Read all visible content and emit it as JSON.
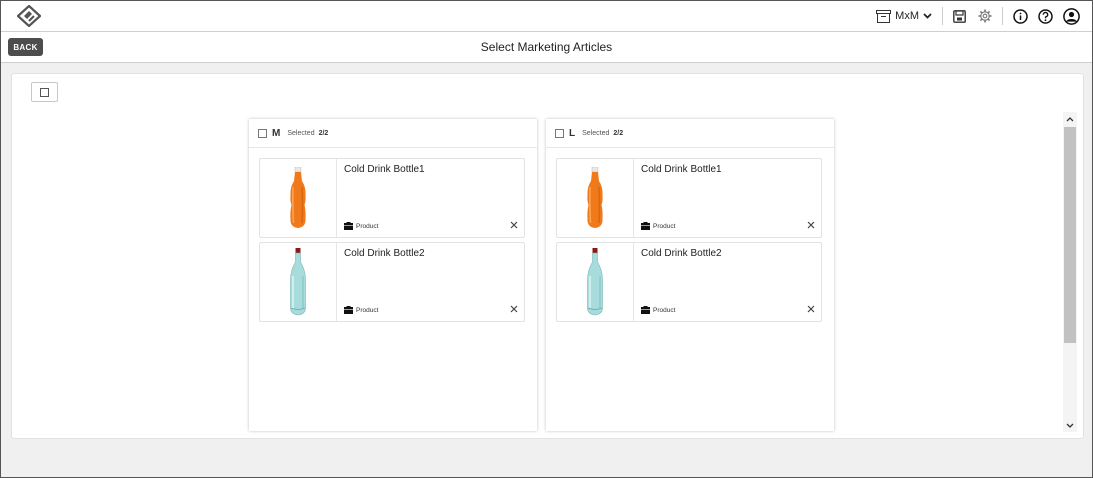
{
  "header": {
    "workspace_label": "MxM",
    "icons": [
      "app-logo-icon",
      "workspace-icon",
      "chevron-down-icon",
      "save-icon",
      "gear-icon",
      "info-icon",
      "help-icon",
      "user-icon"
    ]
  },
  "titlebar": {
    "back_label": "BACK",
    "title": "Select Marketing Articles"
  },
  "columns": [
    {
      "name": "M",
      "selected_label": "Selected",
      "selected_count": "2/2",
      "cards": [
        {
          "title": "Cold Drink Bottle1",
          "type": "Product",
          "bottle_color": "#f07a1a"
        },
        {
          "title": "Cold Drink Bottle2",
          "type": "Product",
          "bottle_color": "#a8dcdc"
        }
      ]
    },
    {
      "name": "L",
      "selected_label": "Selected",
      "selected_count": "2/2",
      "cards": [
        {
          "title": "Cold Drink Bottle1",
          "type": "Product",
          "bottle_color": "#f07a1a"
        },
        {
          "title": "Cold Drink Bottle2",
          "type": "Product",
          "bottle_color": "#a8dcdc"
        }
      ]
    }
  ],
  "colors": {
    "back_button": "#4d4d4d",
    "page_background": "#f0f0f0",
    "scroll_thumb": "#c1c1c1"
  }
}
